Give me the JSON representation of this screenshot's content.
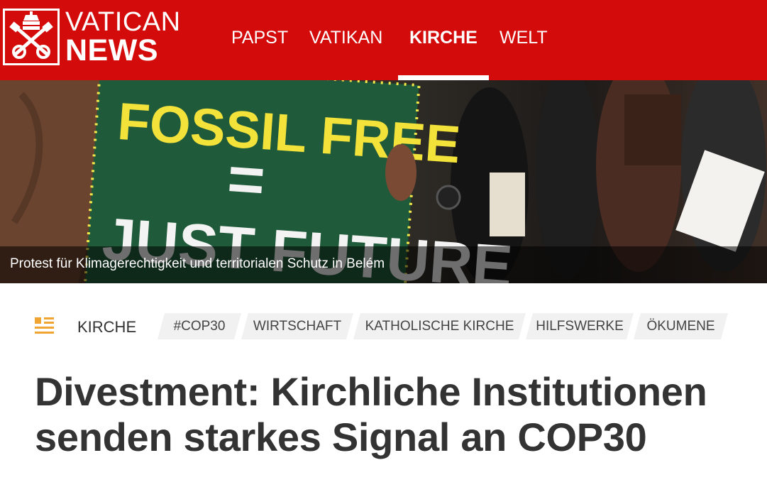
{
  "brand": {
    "line1": "VATICAN",
    "line2": "NEWS",
    "emblem": "papal-keys-emblem-icon",
    "color": "#d40b0b"
  },
  "nav": {
    "items": [
      {
        "label": "PAPST",
        "active": false
      },
      {
        "label": "VATIKAN",
        "active": false
      },
      {
        "label": "KIRCHE",
        "active": true
      },
      {
        "label": "WELT",
        "active": false
      }
    ]
  },
  "hero": {
    "sign_line1": "FOSSIL FREE",
    "sign_line2": "=",
    "sign_line3": "JUST FUTURE",
    "caption": "Protest für Klimagerechtigkeit und territorialen Schutz in Belém"
  },
  "category": {
    "icon": "article-list-icon",
    "label": "KIRCHE",
    "icon_color": "#f0a532"
  },
  "tags": [
    "#COP30",
    "WIRTSCHAFT",
    "KATHOLISCHE KIRCHE",
    "HILFSWERKE",
    "ÖKUMENE"
  ],
  "article": {
    "title": "Divestment: Kirchliche Institutionen senden starkes Signal an COP30"
  }
}
